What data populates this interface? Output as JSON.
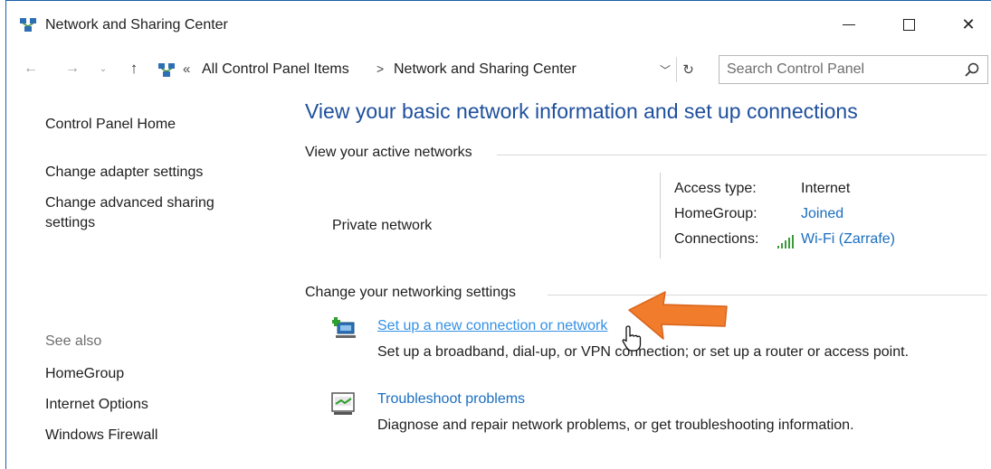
{
  "window": {
    "title": "Network and Sharing Center",
    "controls": {
      "minimize": "minimize",
      "maximize": "maximize",
      "close": "close"
    }
  },
  "address_bar": {
    "chevron": "«",
    "breadcrumbs": [
      "All Control Panel Items",
      "Network and Sharing Center"
    ],
    "separator": ">",
    "search_placeholder": "Search Control Panel"
  },
  "sidebar": {
    "home": "Control Panel Home",
    "links": [
      "Change adapter settings",
      "Change advanced sharing settings"
    ],
    "see_also_label": "See also",
    "see_also": [
      "HomeGroup",
      "Internet Options",
      "Windows Firewall"
    ]
  },
  "main": {
    "heading": "View your basic network information and set up connections",
    "active_networks": {
      "section_label": "View your active networks",
      "network_name": "Private network",
      "access_type_label": "Access type:",
      "access_type_value": "Internet",
      "homegroup_label": "HomeGroup:",
      "homegroup_value": "Joined",
      "connections_label": "Connections:",
      "connections_value": "Wi-Fi (Zarrafe)"
    },
    "change_settings": {
      "section_label": "Change your networking settings",
      "tasks": [
        {
          "title": "Set up a new connection or network",
          "description": "Set up a broadband, dial-up, or VPN connection; or set up a router or access point.",
          "icon": "new-connection-icon"
        },
        {
          "title": "Troubleshoot problems",
          "description": "Diagnose and repair network problems, or get troubleshooting information.",
          "icon": "troubleshoot-icon"
        }
      ]
    }
  },
  "colors": {
    "heading": "#1e4f9c",
    "link": "#1a6ec0",
    "hover_link": "#3390e6",
    "annotation_arrow": "#f07c2c"
  }
}
